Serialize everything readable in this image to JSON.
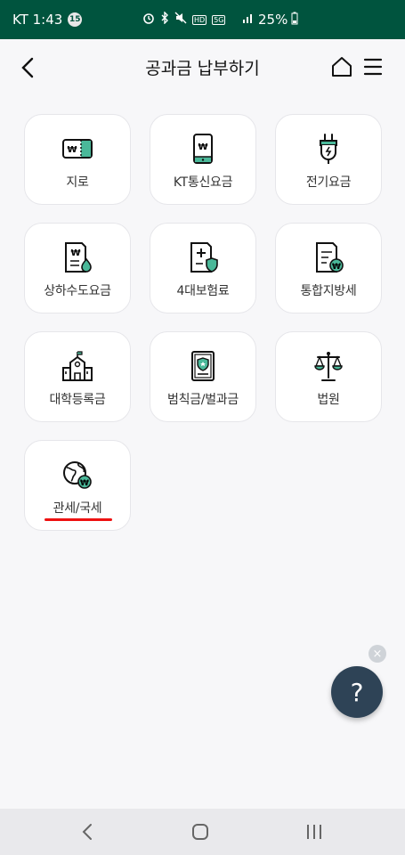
{
  "status": {
    "carrier_time": "KT 1:43",
    "notif_count": "15",
    "network_tag": "HD",
    "lte_tag": "5G",
    "battery": "25%"
  },
  "header": {
    "title": "공과금 납부하기"
  },
  "tiles": [
    {
      "label": "지로",
      "icon": "giro-card-icon"
    },
    {
      "label": "KT통신요금",
      "icon": "phone-bill-icon"
    },
    {
      "label": "전기요금",
      "icon": "plug-icon"
    },
    {
      "label": "상하수도요금",
      "icon": "water-bill-icon"
    },
    {
      "label": "4대보험료",
      "icon": "insurance-doc-icon"
    },
    {
      "label": "통합지방세",
      "icon": "local-tax-icon"
    },
    {
      "label": "대학등록금",
      "icon": "university-icon"
    },
    {
      "label": "범칙금/벌과금",
      "icon": "fine-doc-icon"
    },
    {
      "label": "법원",
      "icon": "scales-icon"
    },
    {
      "label": "관세/국세",
      "icon": "globe-won-icon"
    }
  ],
  "fab": {
    "help_label": "?",
    "close_label": "×"
  },
  "colors": {
    "status_bg": "#00543e",
    "accent_green": "#00543e",
    "fab_bg": "#2e4356",
    "underline": "#e11111"
  }
}
